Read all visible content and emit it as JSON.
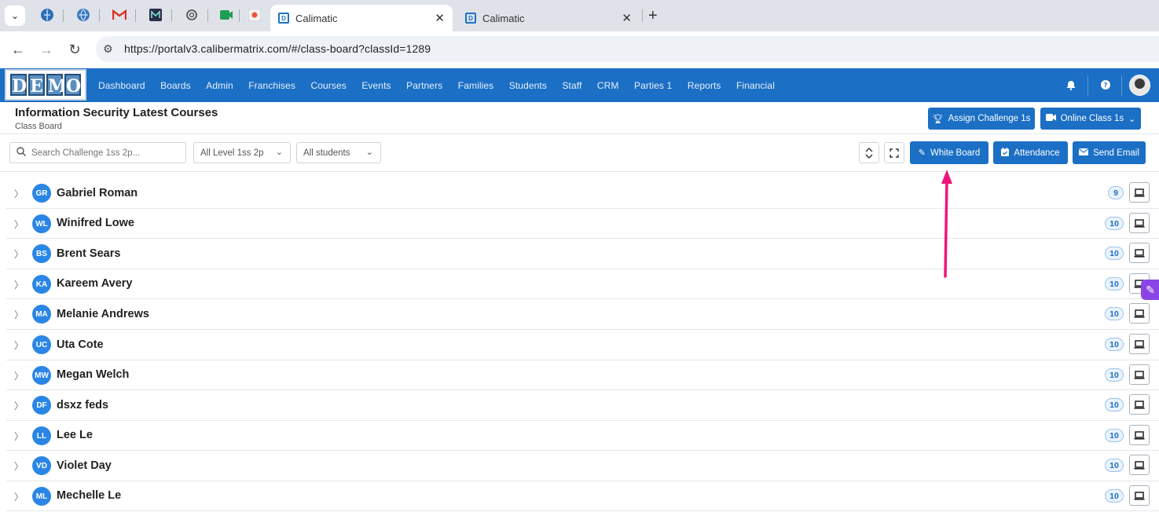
{
  "browser": {
    "tabs": [
      {
        "title": "Calimatic",
        "active": true
      },
      {
        "title": "Calimatic",
        "active": false
      }
    ],
    "pinned_icons": [
      "globe-g-icon",
      "globe-icon",
      "gmail-icon",
      "m-app-icon",
      "openai-icon",
      "meet-icon",
      "record-icon"
    ],
    "new_tab": "+",
    "close_glyph": "✕",
    "url": "https://portalv3.calibermatrix.com/#/class-board?classId=1289"
  },
  "nav": {
    "logo_letters": [
      "D",
      "E",
      "M",
      "O"
    ],
    "menu": [
      "Dashboard",
      "Boards",
      "Admin",
      "Franchises",
      "Courses",
      "Events",
      "Partners",
      "Families",
      "Students",
      "Staff",
      "CRM",
      "Parties 1",
      "Reports",
      "Financial"
    ]
  },
  "header": {
    "title": "Information Security Latest Courses",
    "subtitle": "Class Board",
    "assign_btn": "Assign Challenge 1s",
    "online_btn": "Online Class 1s"
  },
  "toolbar": {
    "search_placeholder": "Search Challenge 1ss 2p...",
    "level_select": "All Level 1ss 2p",
    "students_select": "All students",
    "whiteboard_btn": "White Board",
    "attendance_btn": "Attendance",
    "email_btn": "Send Email"
  },
  "students": [
    {
      "initials": "GR",
      "name": "Gabriel Roman",
      "count": "9"
    },
    {
      "initials": "WL",
      "name": "Winifred Lowe",
      "count": "10"
    },
    {
      "initials": "BS",
      "name": "Brent Sears",
      "count": "10"
    },
    {
      "initials": "KA",
      "name": "Kareem Avery",
      "count": "10"
    },
    {
      "initials": "MA",
      "name": "Melanie Andrews",
      "count": "10"
    },
    {
      "initials": "UC",
      "name": "Uta Cote",
      "count": "10"
    },
    {
      "initials": "MW",
      "name": "Megan Welch",
      "count": "10"
    },
    {
      "initials": "DF",
      "name": "dsxz feds",
      "count": "10"
    },
    {
      "initials": "LL",
      "name": "Lee Le",
      "count": "10"
    },
    {
      "initials": "VD",
      "name": "Violet Day",
      "count": "10"
    },
    {
      "initials": "ML",
      "name": "Mechelle Le",
      "count": "10"
    }
  ],
  "colors": {
    "brand": "#1b6fc5",
    "avatar": "#2a86e6",
    "annotation_arrow": "#f0147a",
    "pen_tab": "#8a45e6"
  }
}
